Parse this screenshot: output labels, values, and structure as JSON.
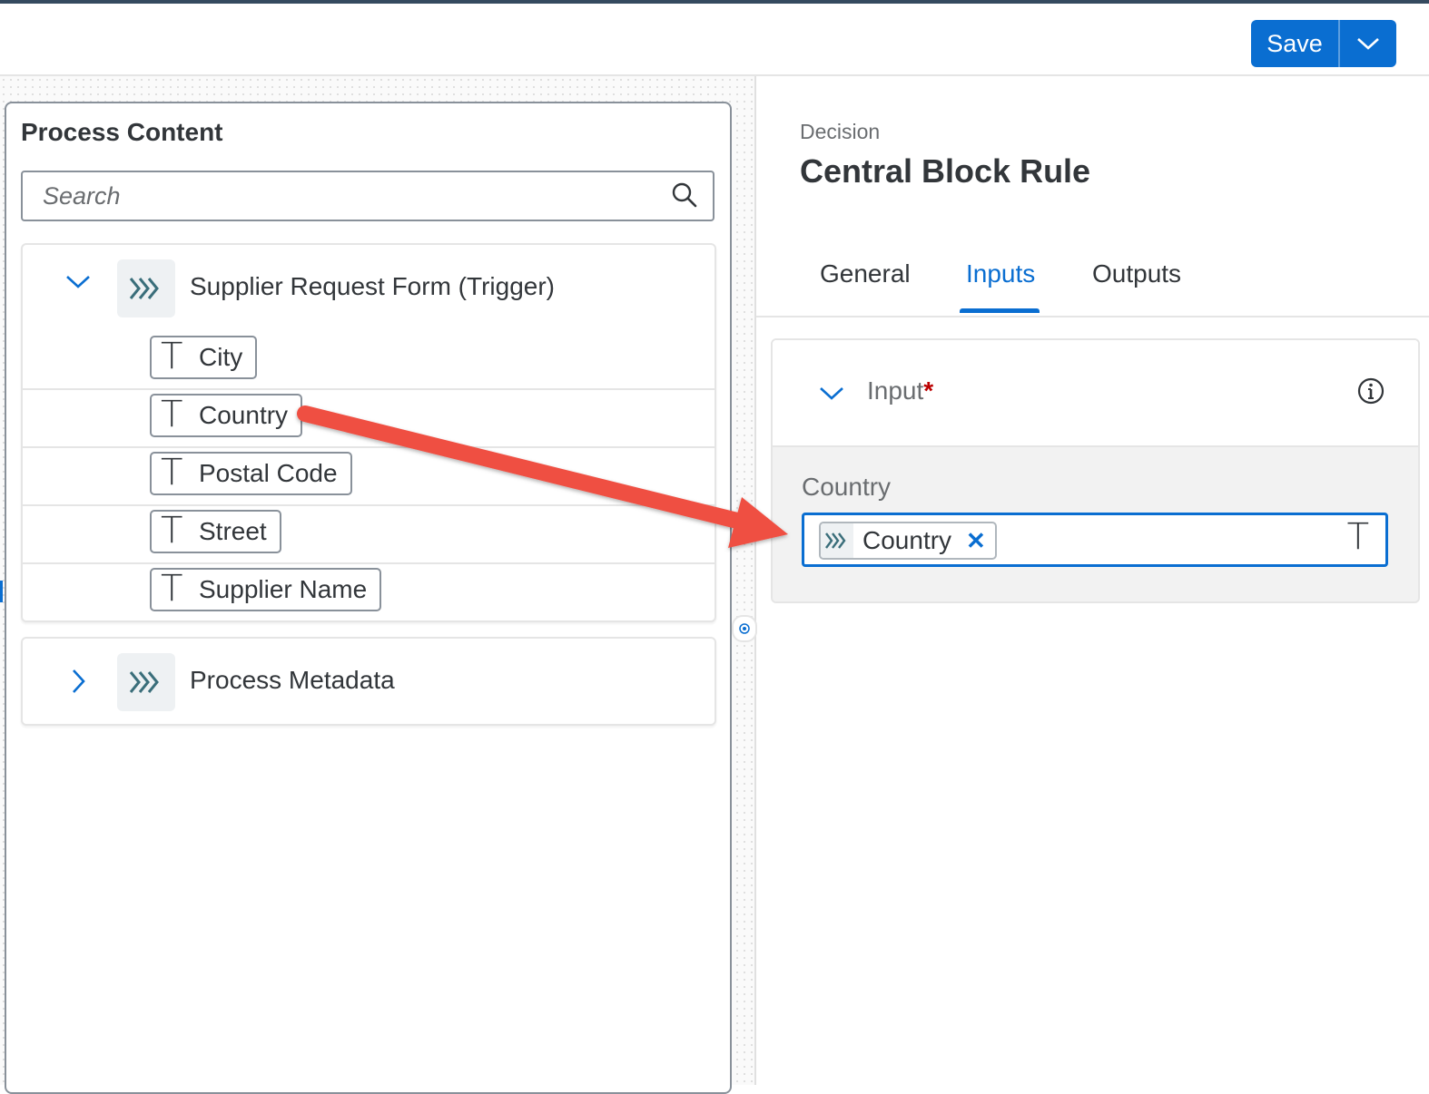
{
  "toolbar": {
    "save_label": "Save",
    "save_dropdown_icon": "chevron-down-icon",
    "accent_color": "#0a6ed1"
  },
  "process_content": {
    "title": "Process Content",
    "search_placeholder": "Search",
    "groups": [
      {
        "label": "Supplier Request Form (Trigger)",
        "expanded": true,
        "icon": "process-trigger-icon",
        "fields": [
          {
            "type_icon": "T",
            "label": "City"
          },
          {
            "type_icon": "T",
            "label": "Country"
          },
          {
            "type_icon": "T",
            "label": "Postal Code"
          },
          {
            "type_icon": "T",
            "label": "Street"
          },
          {
            "type_icon": "T",
            "label": "Supplier Name"
          }
        ]
      },
      {
        "label": "Process Metadata",
        "expanded": false,
        "icon": "process-trigger-icon"
      }
    ]
  },
  "decision": {
    "type_label": "Decision",
    "title": "Central Block Rule",
    "tabs": [
      {
        "label": "General",
        "active": false
      },
      {
        "label": "Inputs",
        "active": true
      },
      {
        "label": "Outputs",
        "active": false
      }
    ],
    "input_section": {
      "header_label": "Input",
      "required_mark": "*",
      "field_label": "Country",
      "token_label": "Country",
      "token_close": "✕",
      "type_icon": "T"
    }
  },
  "annotation": {
    "arrow_color": "#ef4f43"
  }
}
